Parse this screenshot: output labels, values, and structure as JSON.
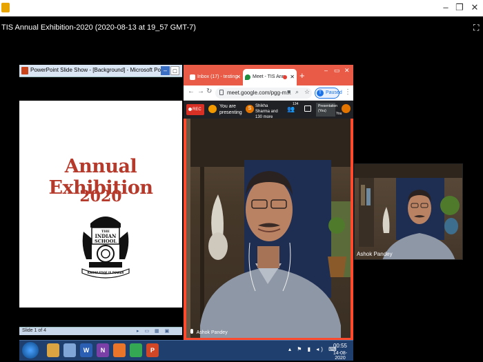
{
  "player": {
    "title": "TIS Annual Exhibition-2020 (2020-08-13 at 19_57 GMT-7)"
  },
  "powerpoint": {
    "window_title": "PowerPoint Slide Show - [Background] - Microsoft PowerPoint ...",
    "slide_title": "Annual Exhibition",
    "slide_year": "2020",
    "logo_text_top": "THE",
    "logo_text_mid": "INDIAN",
    "logo_text_bot": "SCHOOL",
    "logo_motto": "KNOWLEDGE IS POWER",
    "slide_count": "Slide 1 of 4"
  },
  "chrome": {
    "tabs": [
      {
        "label": "Inbox (17) - testing"
      },
      {
        "label": "Meet - TIS Ann"
      }
    ],
    "new_tab": "+",
    "url": "meet.google.com/pgg-m...",
    "profile_initial": "T",
    "profile_label": "Paused"
  },
  "meet": {
    "rec_label": "REC",
    "you_presenting": "You are presenting",
    "participant_initial": "S",
    "participants_text": "Shikha Sharma and 130 more",
    "people_count": "134",
    "present_label": "Presentation (You)",
    "you_label": "You",
    "main_name": "Ashok Pandey",
    "thumb_name": "Ashok Pandey"
  },
  "taskbar": {
    "apps": [
      {
        "label": "",
        "color": "#d9a441"
      },
      {
        "label": "",
        "color": "#7fa6d6"
      },
      {
        "label": "W",
        "color": "#2b5fb4"
      },
      {
        "label": "N",
        "color": "#7b3fa8"
      },
      {
        "label": "",
        "color": "#e8752a"
      },
      {
        "label": "",
        "color": "#34a853"
      },
      {
        "label": "P",
        "color": "#d24726"
      }
    ],
    "time": "00:55",
    "date": "14-08-2020"
  },
  "colors": {
    "slide_red": "#b53a2b",
    "chrome_accent": "#e95b46",
    "meet_dark": "#202124",
    "taskbar": "#1f3f6e"
  }
}
